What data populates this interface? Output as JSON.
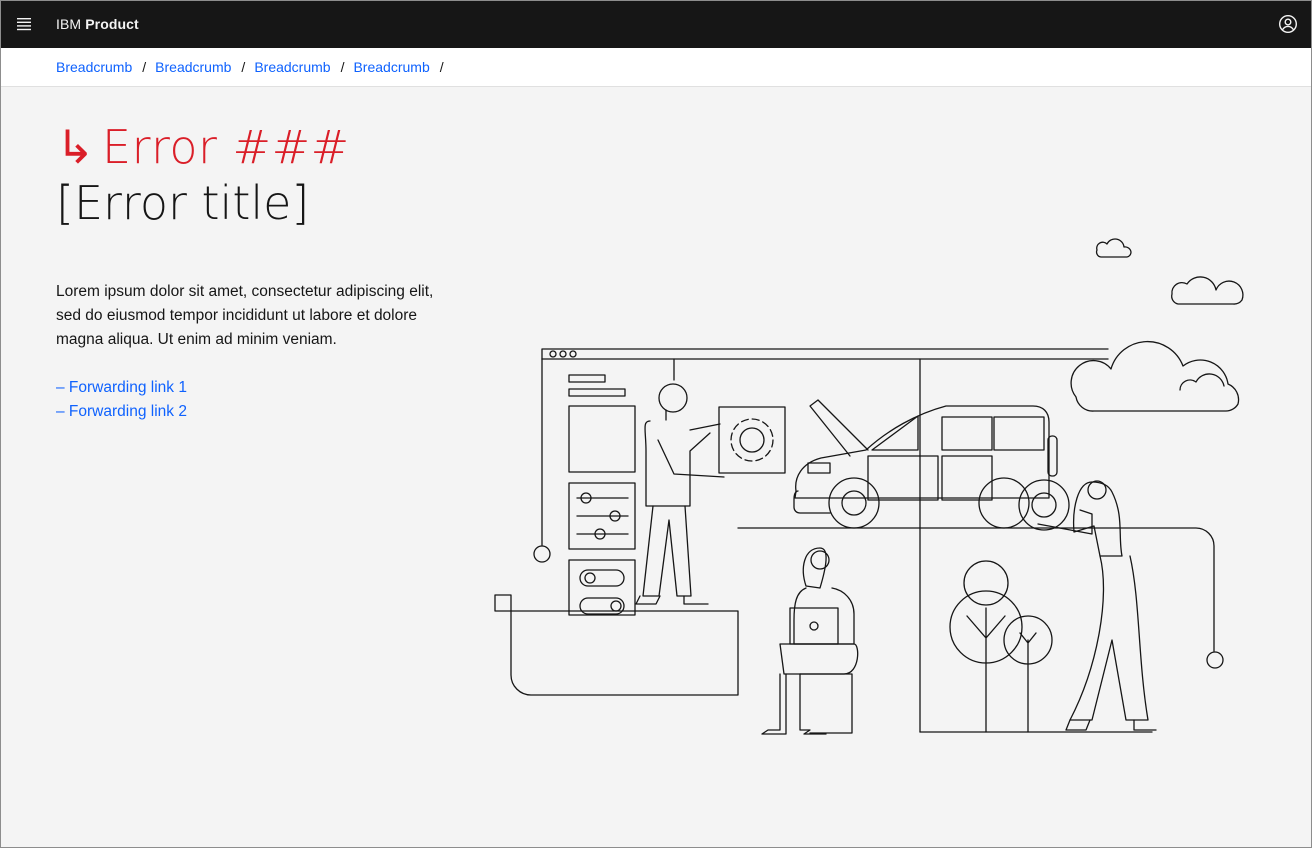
{
  "header": {
    "brand_prefix": "IBM",
    "brand_name": "Product",
    "menu_icon": "hamburger-menu-icon",
    "user_icon": "user-avatar-icon"
  },
  "breadcrumb": {
    "items": [
      "Breadcrumb",
      "Breadcrumb",
      "Breadcrumb",
      "Breadcrumb"
    ],
    "separator": "/"
  },
  "error": {
    "arrow": "↳",
    "code": "Error ###",
    "title": "[Error title]",
    "description": "Lorem ipsum dolor sit amet, consectetur adipiscing elit, sed do eiusmod tempor incididunt ut labore et dolore magna aliqua. Ut enim ad minim veniam.",
    "links": [
      "– Forwarding link 1",
      "– Forwarding link 2"
    ]
  },
  "colors": {
    "header_bg": "#161616",
    "error_red": "#da1e28",
    "link_blue": "#0f62fe",
    "page_bg": "#f4f4f4"
  }
}
